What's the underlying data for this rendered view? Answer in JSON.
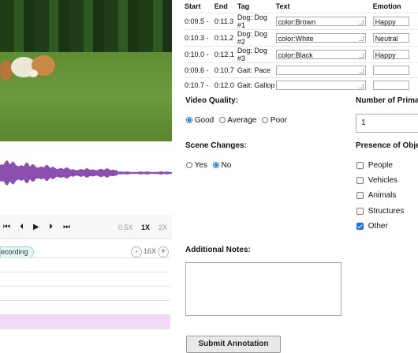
{
  "player": {
    "speeds": [
      "0.5X",
      "1X",
      "2X"
    ],
    "active_speed": "1X",
    "recording_label": "ecording",
    "zoom_level": "16X",
    "zoom_minus": "-",
    "zoom_plus": "+"
  },
  "table": {
    "headers": {
      "start": "Start",
      "end": "End",
      "tag": "Tag",
      "text": "Text",
      "emotion": "Emotion"
    },
    "rows": [
      {
        "start": "0:09.5",
        "sep": "-",
        "end": "0:11.3",
        "tag": "Dog: Dog #1",
        "text": "color:Brown",
        "emotion": "Happy"
      },
      {
        "start": "0:10.3",
        "sep": "-",
        "end": "0:11.2",
        "tag": "Dog: Dog #2",
        "text": "color:White",
        "emotion": "Neutral"
      },
      {
        "start": "0:10.0",
        "sep": "-",
        "end": "0:12.1",
        "tag": "Dog: Dog #3",
        "text": "color:Black",
        "emotion": "Happy"
      },
      {
        "start": "0:09.6",
        "sep": "-",
        "end": "0:10.7",
        "tag": "Gait: Pace",
        "text": "",
        "emotion": ""
      },
      {
        "start": "0:10.7",
        "sep": "-",
        "end": "0:12.0",
        "tag": "Gait: Gallop",
        "text": "",
        "emotion": ""
      }
    ]
  },
  "video_quality": {
    "label": "Video Quality:",
    "options": [
      "Good",
      "Average",
      "Poor"
    ],
    "selected": "Good"
  },
  "scene_changes": {
    "label": "Scene Changes:",
    "options": [
      "Yes",
      "No"
    ],
    "selected": "No"
  },
  "primary": {
    "label": "Number of Prima",
    "value": "1"
  },
  "presence": {
    "label": "Presence of Objec",
    "options": [
      {
        "label": "People",
        "checked": false
      },
      {
        "label": "Vehicles",
        "checked": false
      },
      {
        "label": "Animals",
        "checked": false
      },
      {
        "label": "Structures",
        "checked": false
      },
      {
        "label": "Other",
        "checked": true
      }
    ]
  },
  "notes": {
    "label": "Additional Notes:",
    "value": ""
  },
  "submit": {
    "label": "Submit Annotation"
  },
  "colors": {
    "accent": "#1a73e8",
    "waveform": "#8b4fb0",
    "lane_highlight": "#f2d9f7",
    "recording_badge": "#e4f6f6"
  }
}
